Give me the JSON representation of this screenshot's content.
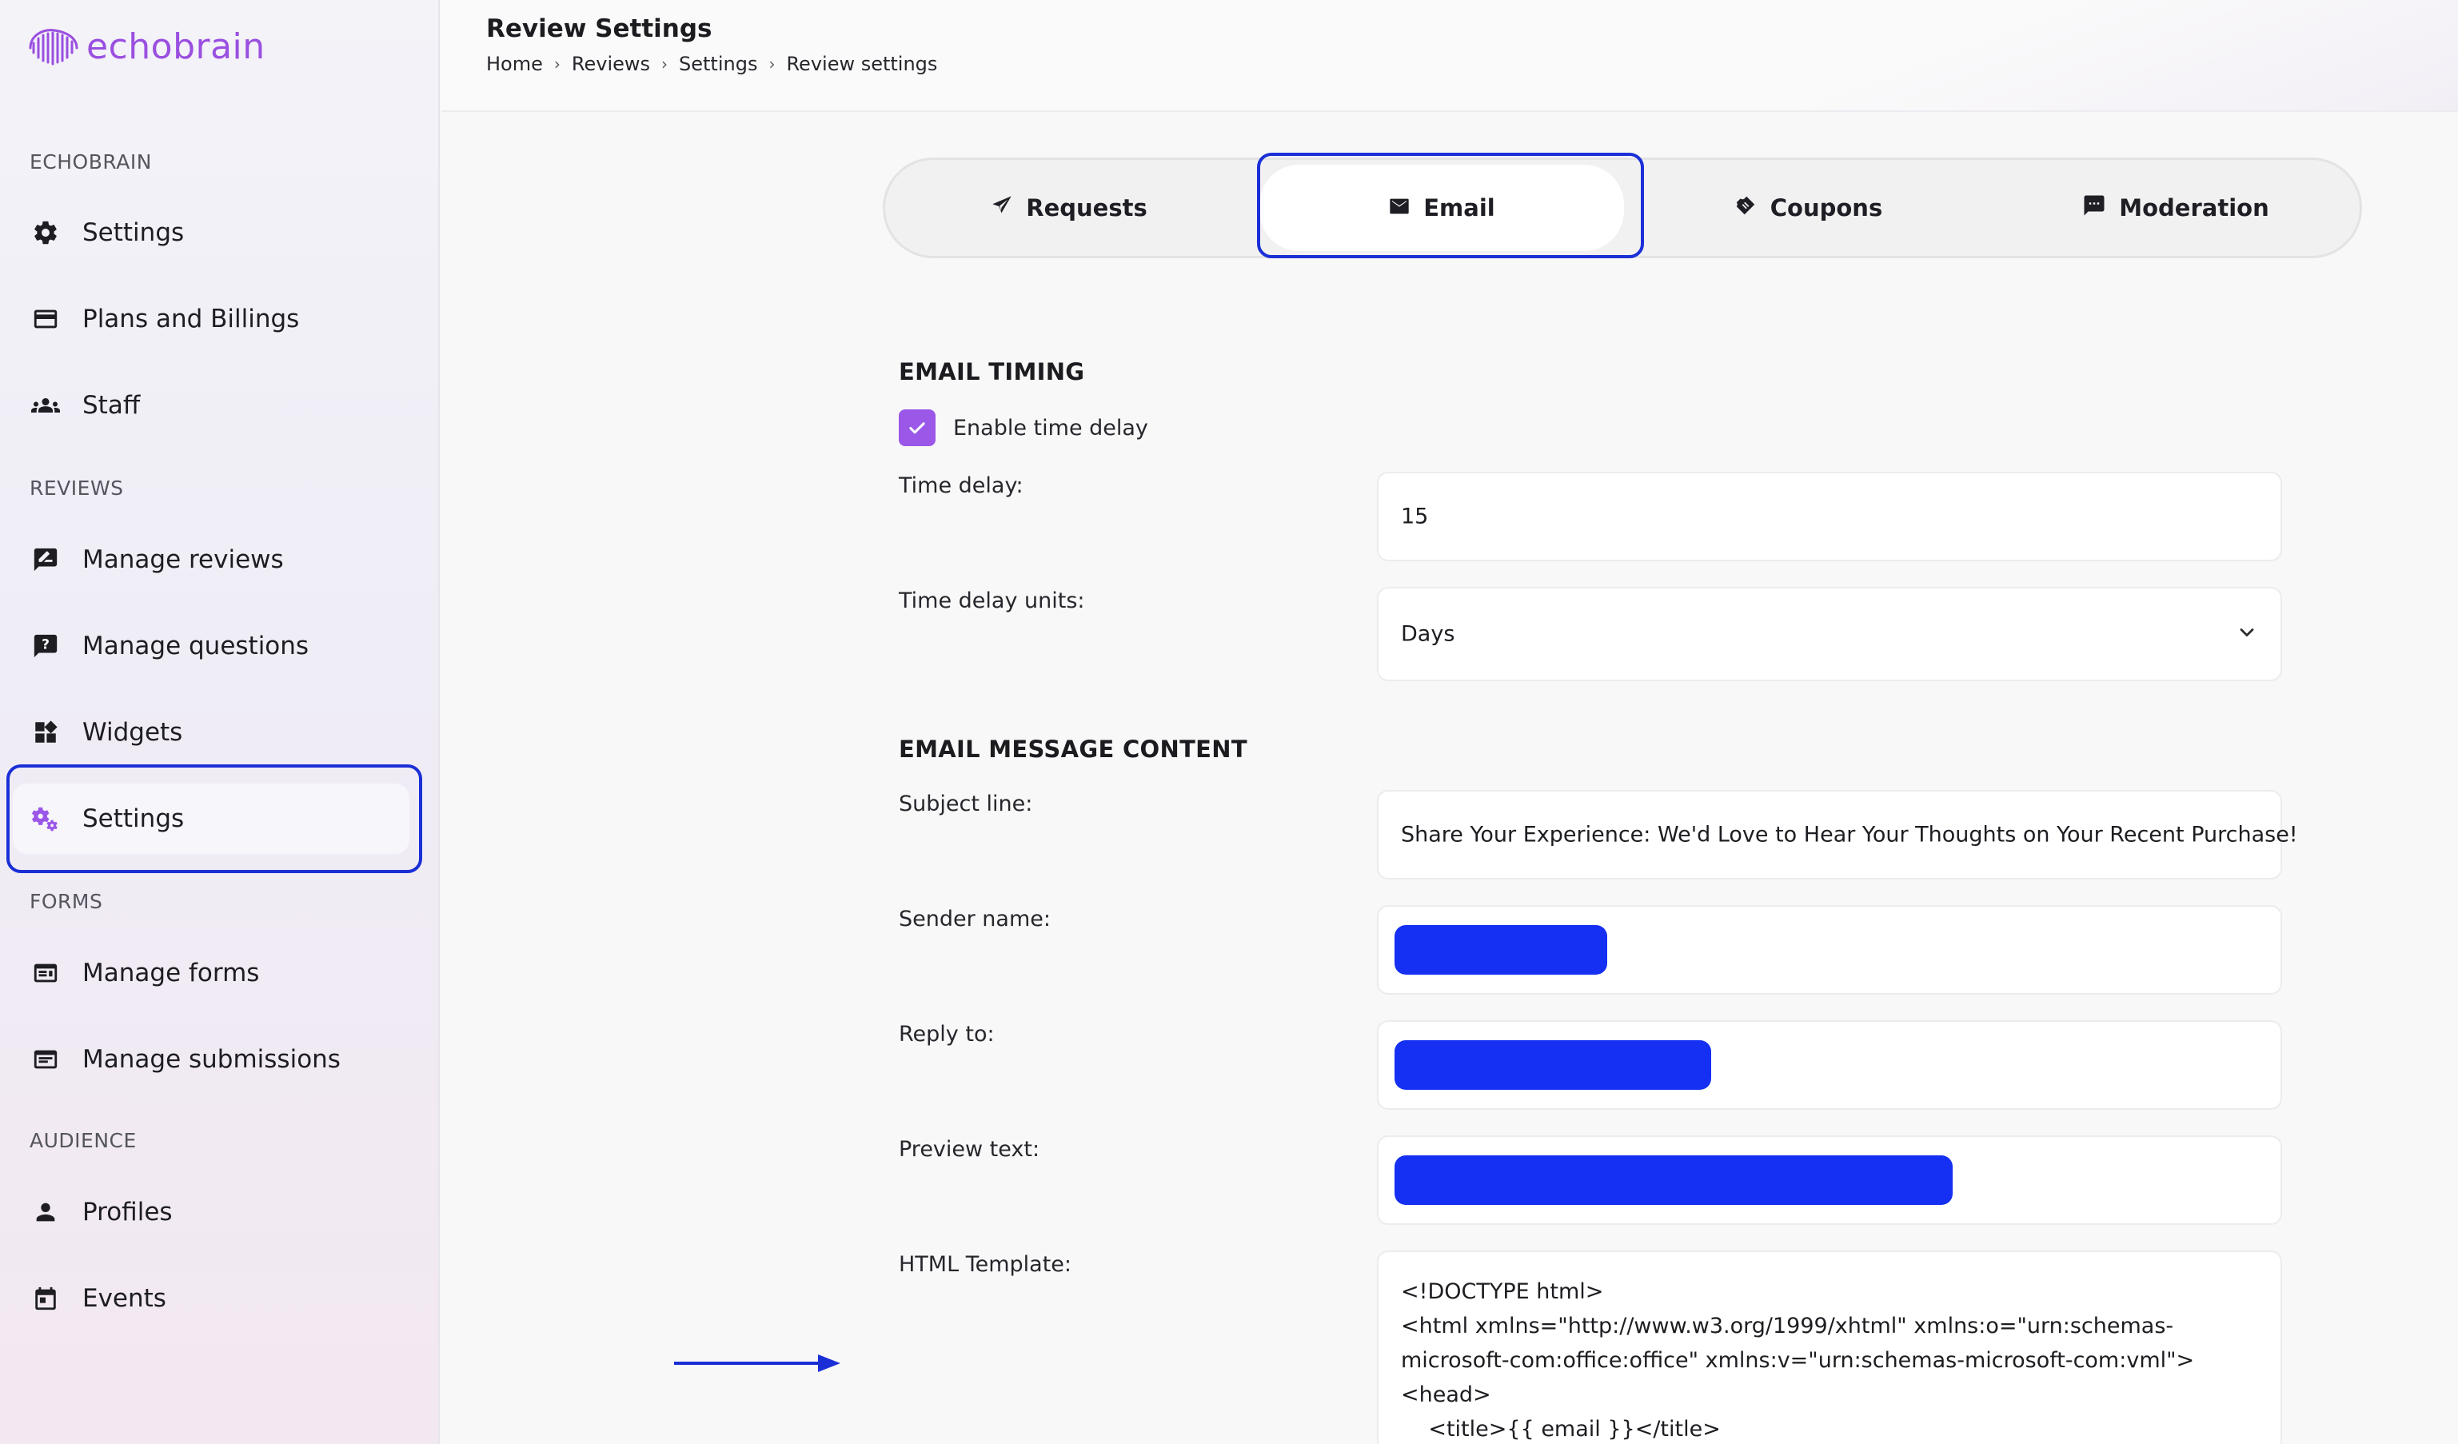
{
  "app": {
    "logo_text": "echobrain"
  },
  "sidebar": {
    "sections": [
      {
        "label": "ECHOBRAIN",
        "items": [
          {
            "label": "Settings",
            "icon": "gear-icon"
          },
          {
            "label": "Plans and Billings",
            "icon": "credit-card-icon"
          },
          {
            "label": "Staff",
            "icon": "group-icon"
          }
        ]
      },
      {
        "label": "REVIEWS",
        "items": [
          {
            "label": "Manage reviews",
            "icon": "rate-review-icon"
          },
          {
            "label": "Manage questions",
            "icon": "question-icon"
          },
          {
            "label": "Widgets",
            "icon": "widgets-icon"
          },
          {
            "label": "Settings",
            "icon": "settings-cog-icon",
            "active": true
          }
        ]
      },
      {
        "label": "FORMS",
        "items": [
          {
            "label": "Manage forms",
            "icon": "form-icon"
          },
          {
            "label": "Manage submissions",
            "icon": "submissions-icon"
          }
        ]
      },
      {
        "label": "AUDIENCE",
        "items": [
          {
            "label": "Profiles",
            "icon": "person-icon"
          },
          {
            "label": "Events",
            "icon": "calendar-icon"
          }
        ]
      }
    ],
    "accent_color": "#9b57e8",
    "highlight_color": "#1a2fd6"
  },
  "header": {
    "title": "Review Settings",
    "breadcrumb": [
      "Home",
      "Reviews",
      "Settings",
      "Review settings"
    ],
    "breadcrumb_separator": "›"
  },
  "tabs": [
    {
      "label": "Requests",
      "icon": "send-icon"
    },
    {
      "label": "Email",
      "icon": "mail-icon",
      "active": true
    },
    {
      "label": "Coupons",
      "icon": "ticket-icon"
    },
    {
      "label": "Moderation",
      "icon": "comment-icon"
    }
  ],
  "email_timing": {
    "heading": "EMAIL TIMING",
    "enable_time_delay": {
      "label": "Enable time delay",
      "checked": true
    },
    "time_delay": {
      "label": "Time delay:",
      "value": "15"
    },
    "time_delay_units": {
      "label": "Time delay units:",
      "value": "Days"
    }
  },
  "email_content": {
    "heading": "EMAIL MESSAGE CONTENT",
    "subject_line": {
      "label": "Subject line:",
      "value": "Share Your Experience: We'd Love to Hear Your Thoughts on Your Recent Purchase!"
    },
    "sender_name": {
      "label": "Sender name:",
      "redacted": true
    },
    "reply_to": {
      "label": "Reply to:",
      "redacted": true
    },
    "preview_text": {
      "label": "Preview text:",
      "redacted": true
    },
    "html_template": {
      "label": "HTML Template:",
      "value": "<!DOCTYPE html>\n<html xmlns=\"http://www.w3.org/1999/xhtml\" xmlns:o=\"urn:schemas-microsoft-com:office:office\" xmlns:v=\"urn:schemas-microsoft-com:vml\">\n<head>\n    <title>{{ email }}</title>"
    }
  },
  "redaction_color": "#1530f2"
}
